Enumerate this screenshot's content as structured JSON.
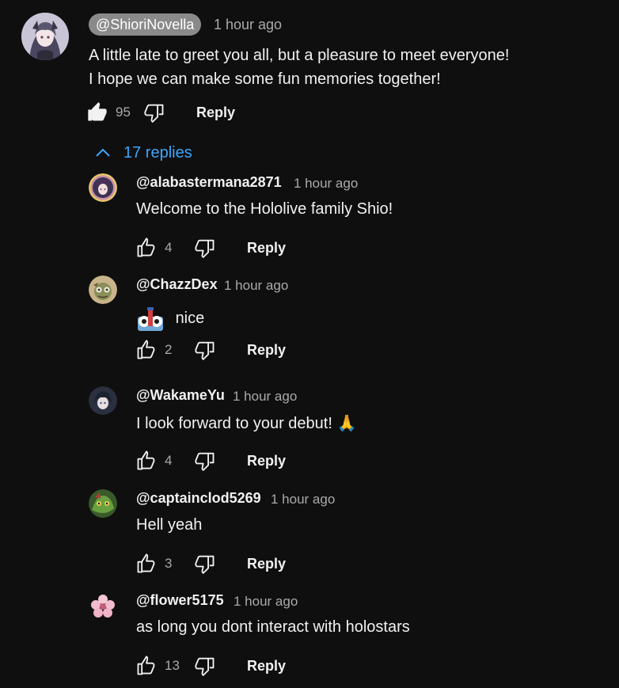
{
  "main_comment": {
    "author": "@ShioriNovella",
    "timestamp": "1 hour ago",
    "text_line1": "A little late to greet you all, but a pleasure to meet everyone!",
    "text_line2": "I hope we can make some fun memories together!",
    "like_count": "95",
    "reply_label": "Reply"
  },
  "replies_toggle": {
    "label": "17 replies",
    "icon": "chevron-up-icon",
    "color": "#3ea6ff"
  },
  "replies": [
    {
      "author": "@alabastermana2871",
      "timestamp": "1 hour ago",
      "text": "Welcome to the Hololive family Shio!",
      "like_count": "4",
      "reply_label": "Reply"
    },
    {
      "author": "@ChazzDex",
      "timestamp": "1 hour ago",
      "text": "nice",
      "emoji": "custom-emote-icon",
      "like_count": "2",
      "reply_label": "Reply"
    },
    {
      "author": "@WakameYu",
      "timestamp": "1 hour ago",
      "text": "I look forward to your debut! 🙏",
      "like_count": "4",
      "reply_label": "Reply"
    },
    {
      "author": "@captainclod5269",
      "timestamp": "1 hour ago",
      "text": "Hell yeah",
      "like_count": "3",
      "reply_label": "Reply"
    },
    {
      "author": "@flower5175",
      "timestamp": "1 hour ago",
      "text": "as long you dont interact with holostars",
      "like_count": "13",
      "reply_label": "Reply"
    }
  ],
  "colors": {
    "background": "#0f0f0f",
    "text": "#f1f1f1",
    "secondary_text": "#aaaaaa",
    "author_chip": "#8a8a8a",
    "link_blue": "#3ea6ff"
  }
}
